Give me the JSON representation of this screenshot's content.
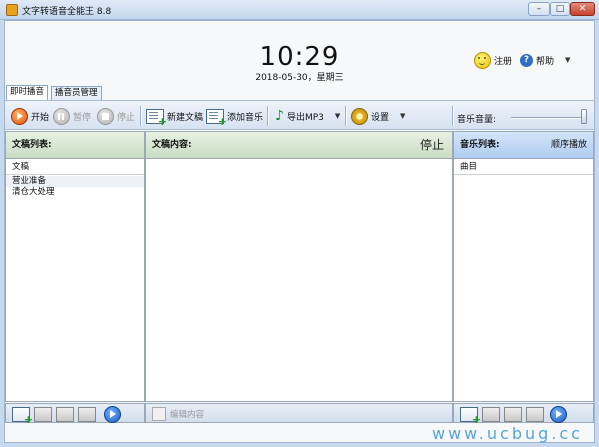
{
  "window": {
    "title": "文字转语音全能王 8.8",
    "controls": {
      "minimize": "–",
      "maximize": "□",
      "close": "✕"
    }
  },
  "header": {
    "time": "10:29",
    "date": "2018-05-30，星期三",
    "register_label": "注册",
    "help_label": "帮助",
    "help_icon": "?",
    "help_caret": "▼"
  },
  "tabs": [
    {
      "label": "即时播音"
    },
    {
      "label": "播音员管理"
    }
  ],
  "toolbar": {
    "start_label": "开始",
    "pause_label": "暂停",
    "stop_label": "停止",
    "new_doc_label": "新建文稿",
    "add_music_label": "添加音乐",
    "export_label": "导出MP3",
    "settings_label": "设置",
    "caret": "▼",
    "volume_label": "音乐音量:",
    "volume_level": 1.0
  },
  "left_panel": {
    "title": "文稿列表:",
    "column": "文稿",
    "items": [
      "营业准备",
      "清仓大处理"
    ]
  },
  "mid_panel": {
    "title": "文稿内容:",
    "status": "停止",
    "edit_label": "编辑内容"
  },
  "right_panel": {
    "title": "音乐列表:",
    "mode": "顺序播放",
    "column": "曲目",
    "items": []
  },
  "watermark": "www.ucbug.cc"
}
